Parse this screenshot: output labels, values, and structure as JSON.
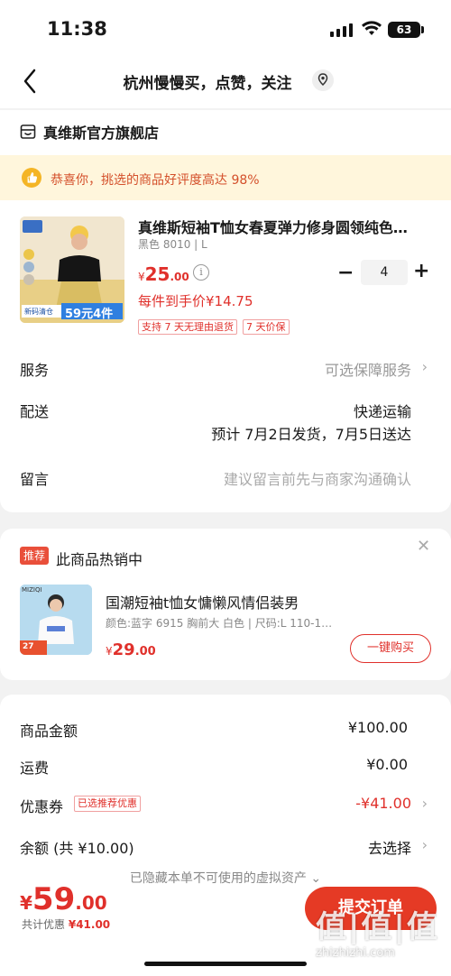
{
  "status_bar": {
    "time": "11:38",
    "battery": "63"
  },
  "nav": {
    "title": "杭州慢慢买，点赞，关注"
  },
  "store": {
    "name": "真维斯官方旗舰店"
  },
  "promo": {
    "text": "恭喜你，挑选的商品好评度高达 98%"
  },
  "product": {
    "title": "真维斯短袖T恤女春夏弹力修身圆领纯色…",
    "sku": "黑色 8010 | L",
    "price_symbol": "¥",
    "price_int": "25",
    "price_dec": ".00",
    "quantity": "4",
    "unit_price": "每件到手价¥14.75",
    "tags": [
      "支持 7 天无理由退货",
      "7 天价保"
    ],
    "image_text": "59元4件",
    "image_sub": "新码清仓"
  },
  "rows": {
    "service": {
      "label": "服务",
      "value": "可选保障服务"
    },
    "delivery": {
      "label": "配送",
      "value": "快递运输",
      "eta": "预计 7月2日发货，7月5日送达"
    },
    "message": {
      "label": "留言",
      "placeholder": "建议留言前先与商家沟通确认"
    }
  },
  "recommend": {
    "badge": "推荐",
    "heading": "此商品热销中",
    "title": "国潮短袖t恤女慵懒风情侣装男",
    "subtitle": "颜色:蓝字 6915 胸前大 白色 | 尺码:L 110-1…",
    "price_symbol": "¥",
    "price_int": "29",
    "price_dec": ".00",
    "buy_label": "一键购买",
    "image_brand": "MIZIQI",
    "image_text": "27"
  },
  "summary": {
    "goods_label": "商品金额",
    "goods_value": "¥100.00",
    "shipping_label": "运费",
    "shipping_value": "¥0.00",
    "coupon_label": "优惠券",
    "coupon_tag": "已选推荐优惠",
    "coupon_value": "-¥41.00",
    "balance_label": "余额 (共 ¥10.00)",
    "balance_value": "去选择",
    "hidden_note": "已隐藏本单不可使用的虚拟资产"
  },
  "bottom": {
    "total_symbol": "¥",
    "total_int": "59",
    "total_dec": ".00",
    "discount_label": "共计优惠",
    "discount_value": "¥41.00",
    "submit_label": "提交订单"
  },
  "watermark": {
    "logo": "值|值|值",
    "url": "zhizhizhi.com"
  },
  "colors": {
    "accent": "#e0302b",
    "button": "#e53a25",
    "promo_bg": "#fff6dc"
  }
}
